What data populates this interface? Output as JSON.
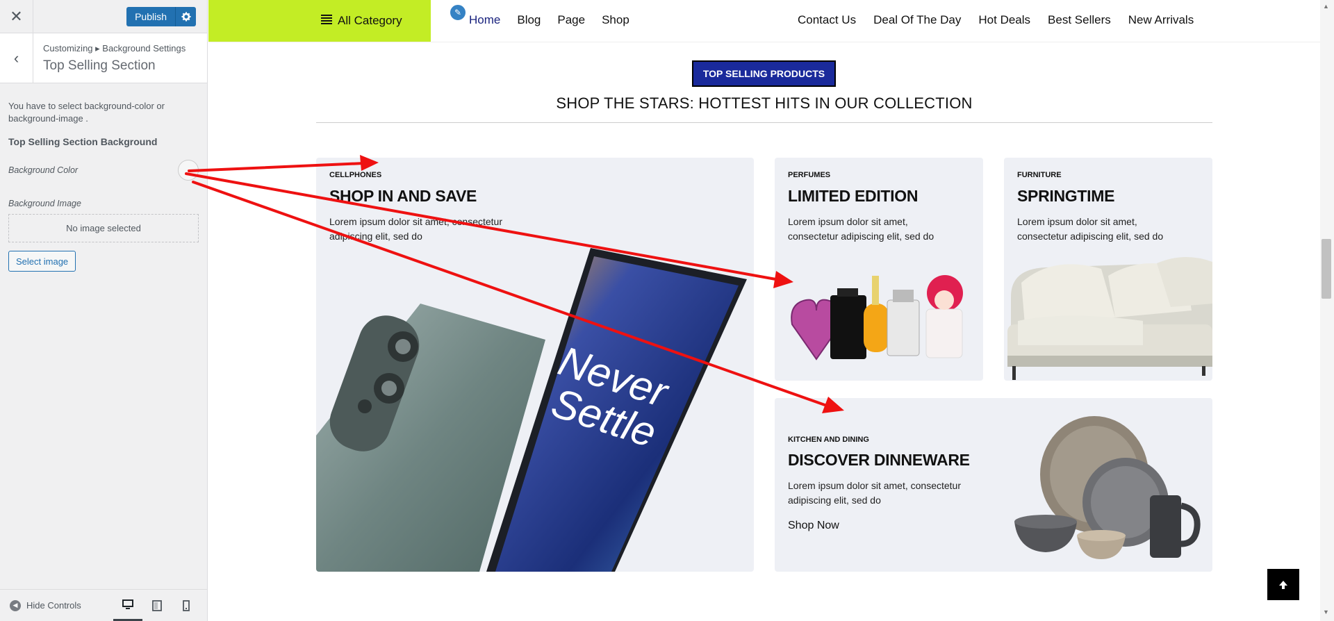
{
  "sidebar": {
    "close_icon": "close-icon",
    "publish_label": "Publish",
    "breadcrumb": "Customizing ▸ Background Settings",
    "section_title": "Top Selling Section",
    "notice": "You have to select background-color or background-image .",
    "bg_heading": "Top Selling Section Background",
    "bg_color_label": "Background Color",
    "bg_image_label": "Background Image",
    "no_image": "No image selected",
    "select_image": "Select image",
    "hide_controls": "Hide Controls"
  },
  "site": {
    "all_category": "All Category",
    "nav_left": [
      "Home",
      "Blog",
      "Page",
      "Shop"
    ],
    "nav_right": [
      "Contact Us",
      "Deal Of The Day",
      "Hot Deals",
      "Best Sellers",
      "New Arrivals"
    ],
    "badge": "TOP SELLING PRODUCTS",
    "heading": "SHOP THE STARS: HOTTEST HITS IN OUR COLLECTION",
    "cards": {
      "phones": {
        "category": "CELLPHONES",
        "title": "SHOP IN AND SAVE",
        "desc1": "Lorem ipsum dolor sit amet, consectetur",
        "desc2": "adipiscing elit, sed do",
        "art_text1": "Never",
        "art_text2": "Settle"
      },
      "perfume": {
        "category": "PERFUMES",
        "title": "LIMITED EDITION",
        "desc1": "Lorem ipsum dolor sit amet,",
        "desc2": "consectetur adipiscing elit, sed do"
      },
      "furniture": {
        "category": "FURNITURE",
        "title": "SPRINGTIME",
        "desc1": "Lorem ipsum dolor sit amet,",
        "desc2": "consectetur adipiscing elit, sed do"
      },
      "kitchen": {
        "category": "KITCHEN AND DINING",
        "title": "DISCOVER DINNEWARE",
        "desc1": "Lorem ipsum dolor sit amet, consectetur",
        "desc2": "adipiscing elit, sed do",
        "shop_now": "Shop Now"
      }
    }
  },
  "colors": {
    "accent_green": "#c3ed25",
    "badge_blue": "#1a2a9b",
    "wp_blue": "#2271b1",
    "arrow_red": "#ee1111"
  }
}
